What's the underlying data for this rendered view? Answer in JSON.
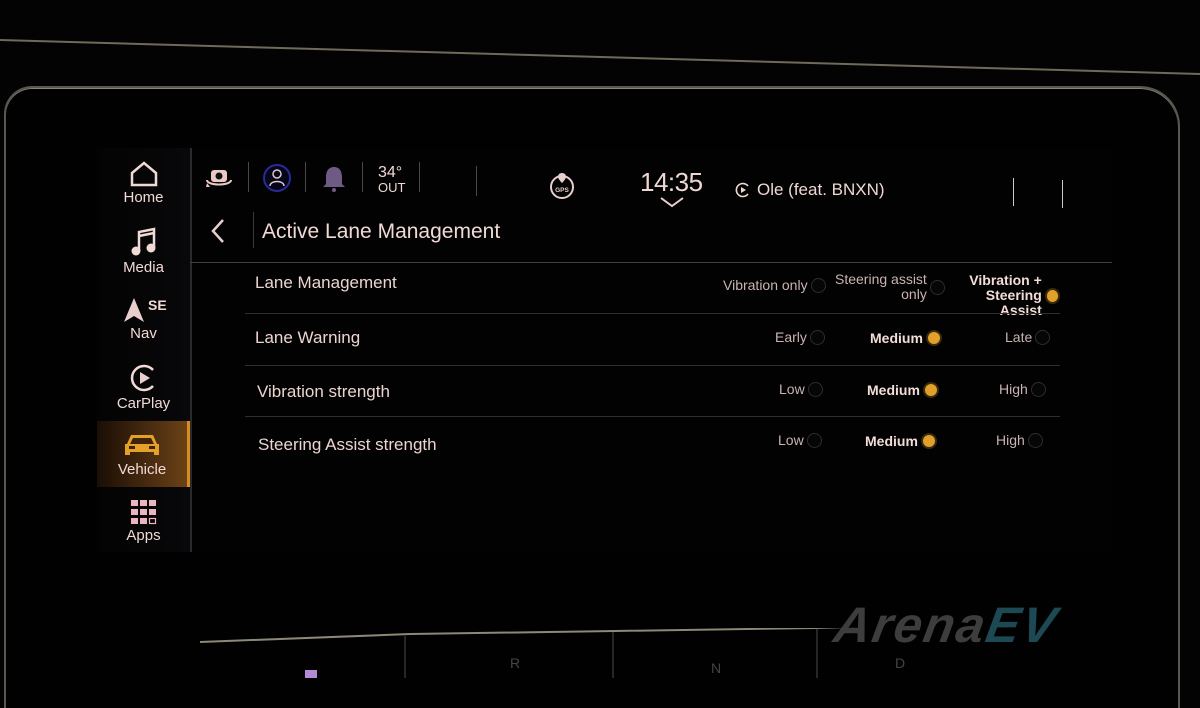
{
  "sidebar": {
    "items": [
      {
        "label": "Home",
        "icon": "home-icon"
      },
      {
        "label": "Media",
        "icon": "music-note-icon"
      },
      {
        "label": "Nav",
        "icon": "navigation-arrow-icon",
        "direction": "SE"
      },
      {
        "label": "CarPlay",
        "icon": "carplay-icon"
      },
      {
        "label": "Vehicle",
        "icon": "car-icon",
        "active": true
      },
      {
        "label": "Apps",
        "icon": "apps-grid-icon"
      }
    ]
  },
  "status_bar": {
    "icons": [
      "camera-rotate-icon",
      "driver-attention-icon",
      "bell-icon",
      "gps-icon"
    ],
    "temperature": "34°",
    "temperature_label": "OUT",
    "gps_label": "GPS",
    "time": "14:35",
    "now_playing": "Ole (feat. BNXN)"
  },
  "page": {
    "title": "Active Lane Management"
  },
  "settings": [
    {
      "label": "Lane Management",
      "options": [
        {
          "label": "Vibration only",
          "selected": false
        },
        {
          "label_line1": "Steering assist",
          "label_line2": "only",
          "selected": false
        },
        {
          "label_line1": "Vibration +",
          "label_line2": "Steering Assist",
          "selected": true
        }
      ]
    },
    {
      "label": "Lane Warning",
      "options": [
        {
          "label": "Early",
          "selected": false
        },
        {
          "label": "Medium",
          "selected": true
        },
        {
          "label": "Late",
          "selected": false
        }
      ]
    },
    {
      "label": "Vibration strength",
      "options": [
        {
          "label": "Low",
          "selected": false
        },
        {
          "label": "Medium",
          "selected": true
        },
        {
          "label": "High",
          "selected": false
        }
      ]
    },
    {
      "label": "Steering Assist strength",
      "options": [
        {
          "label": "Low",
          "selected": false
        },
        {
          "label": "Medium",
          "selected": true
        },
        {
          "label": "High",
          "selected": false
        }
      ]
    }
  ],
  "console": {
    "gears": [
      "R",
      "N",
      "D"
    ]
  },
  "watermark": {
    "text": "Arena",
    "suffix": "EV"
  },
  "colors": {
    "accent": "#e0a02a",
    "text": "#ecd5d1"
  }
}
